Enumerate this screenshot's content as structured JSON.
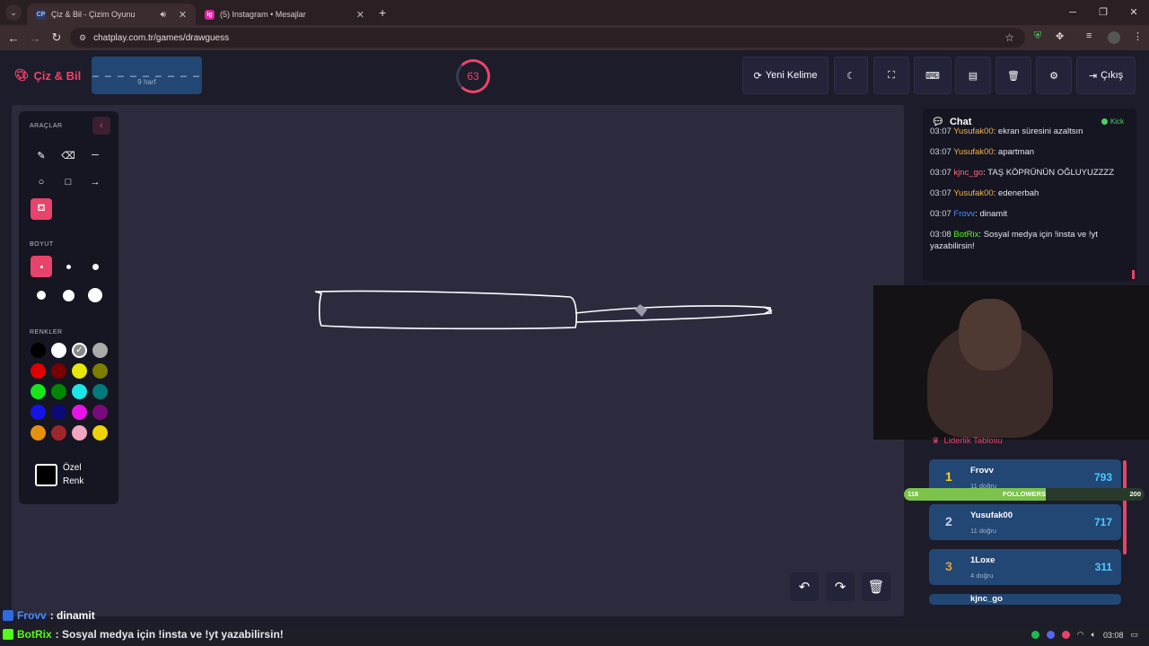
{
  "browser": {
    "tabs": [
      {
        "label": "Çiz & Bil - Çizim Oyunu",
        "favicon": "CP",
        "active": true
      },
      {
        "label": "(5) Instagram • Mesajlar",
        "favicon": "ig",
        "active": false
      }
    ],
    "new_tab": "+",
    "url": "chatplay.com.tr/games/drawguess"
  },
  "header": {
    "logo": "Çiz & Bil",
    "word_dashes": "_ _ _ _ _ _ _ _ _",
    "word_count": "9 harf",
    "timer": "63",
    "new_word_label": "Yeni Kelime",
    "exit_label": "Çıkış"
  },
  "toolbox": {
    "tools_label": "ARAÇLAR",
    "size_label": "BOYUT",
    "colors_label": "RENKLER",
    "custom_color": [
      "Özel",
      "Renk"
    ],
    "colors": [
      "#000000",
      "#ffffff",
      "#888888",
      "#aaaaaa",
      "#e00000",
      "#7a0000",
      "#e6e60a",
      "#7d7d00",
      "#19e619",
      "#008800",
      "#1ae6e6",
      "#007a7a",
      "#1414e6",
      "#0a0a7a",
      "#e614e6",
      "#7a0a7a",
      "#e6900f",
      "#a0262b",
      "#f0a6c0",
      "#f0d20a"
    ]
  },
  "chat": {
    "title": "Chat",
    "platform": "Kick",
    "messages": [
      {
        "time": "03:07",
        "user": "Yusufak00",
        "color": "#f0b44a",
        "text": "ekran süresini azaltsın"
      },
      {
        "time": "03:07",
        "user": "Yusufak00",
        "color": "#f0b44a",
        "text": "apartman"
      },
      {
        "time": "03:07",
        "user": "kjnc_go",
        "color": "#ff6a7a",
        "text": "TAŞ KÖPRÜNÜN OĞLUYUZZZZ"
      },
      {
        "time": "03:07",
        "user": "Yusufak00",
        "color": "#f0b44a",
        "text": "edenerbah"
      },
      {
        "time": "03:07",
        "user": "Frovv",
        "color": "#4a8cff",
        "text": "dinamit"
      },
      {
        "time": "03:08",
        "user": "BotRix",
        "color": "#53fc18",
        "text": "Sosyal medya için !insta ve !yt yazabilirsin!"
      }
    ]
  },
  "leaderboard": {
    "title": "Liderlik Tablosu",
    "rows": [
      {
        "rank": "1",
        "name": "Frovv",
        "sub": "11 doğru",
        "score": "793",
        "rank_color": "#ffd21f"
      },
      {
        "rank": "2",
        "name": "Yusufak00",
        "sub": "11 doğru",
        "score": "717",
        "rank_color": "#c8d4e4"
      },
      {
        "rank": "3",
        "name": "1Loxe",
        "sub": "4 doğru",
        "score": "311",
        "rank_color": "#e0a040"
      },
      {
        "rank": "",
        "name": "kjnc_go",
        "sub": "",
        "score": "",
        "rank_color": "#ffffff"
      }
    ]
  },
  "followers": {
    "label": "FOLLOWERS",
    "current": "118",
    "goal": "200",
    "progress": 0.59
  },
  "overlay": {
    "line1_user": "Frovv",
    "line1_text": ": dinamit",
    "line2_user": "BotRix",
    "line2_text": ": Sosyal medya için !insta ve !yt yazabilirsin!"
  },
  "taskbar": {
    "time": "03:08"
  }
}
